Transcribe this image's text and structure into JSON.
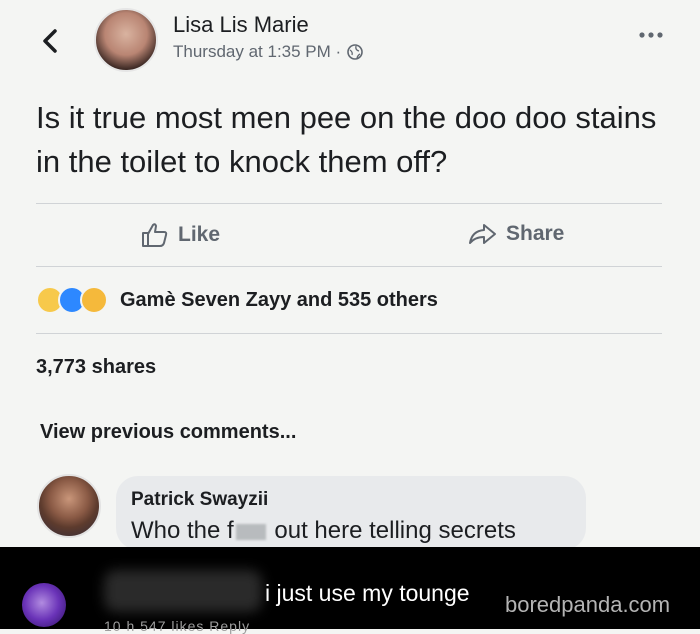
{
  "post": {
    "author": "Lisa Lis Marie",
    "meta": "Thursday at 1:35 PM ·",
    "text": "Is it true most men pee on the doo doo stains in the toilet to knock them off?"
  },
  "actions": {
    "like_label": "Like",
    "share_label": "Share"
  },
  "reactions": {
    "summary": "Gamè Seven Zayy and 535 others"
  },
  "shares": "3,773 shares",
  "view_previous": "View previous comments...",
  "comment": {
    "author": "Patrick Swayzii",
    "text_before": "Who the f",
    "text_after": "out here telling secrets"
  },
  "reply": {
    "text": "i just use my tounge",
    "meta": "10 h   547 likes   Reply"
  },
  "watermark": "boredpanda.com",
  "colors": {
    "reaction_haha": "#f7c94b",
    "reaction_like": "#2d88ff",
    "reaction_wow": "#f5b93b"
  }
}
